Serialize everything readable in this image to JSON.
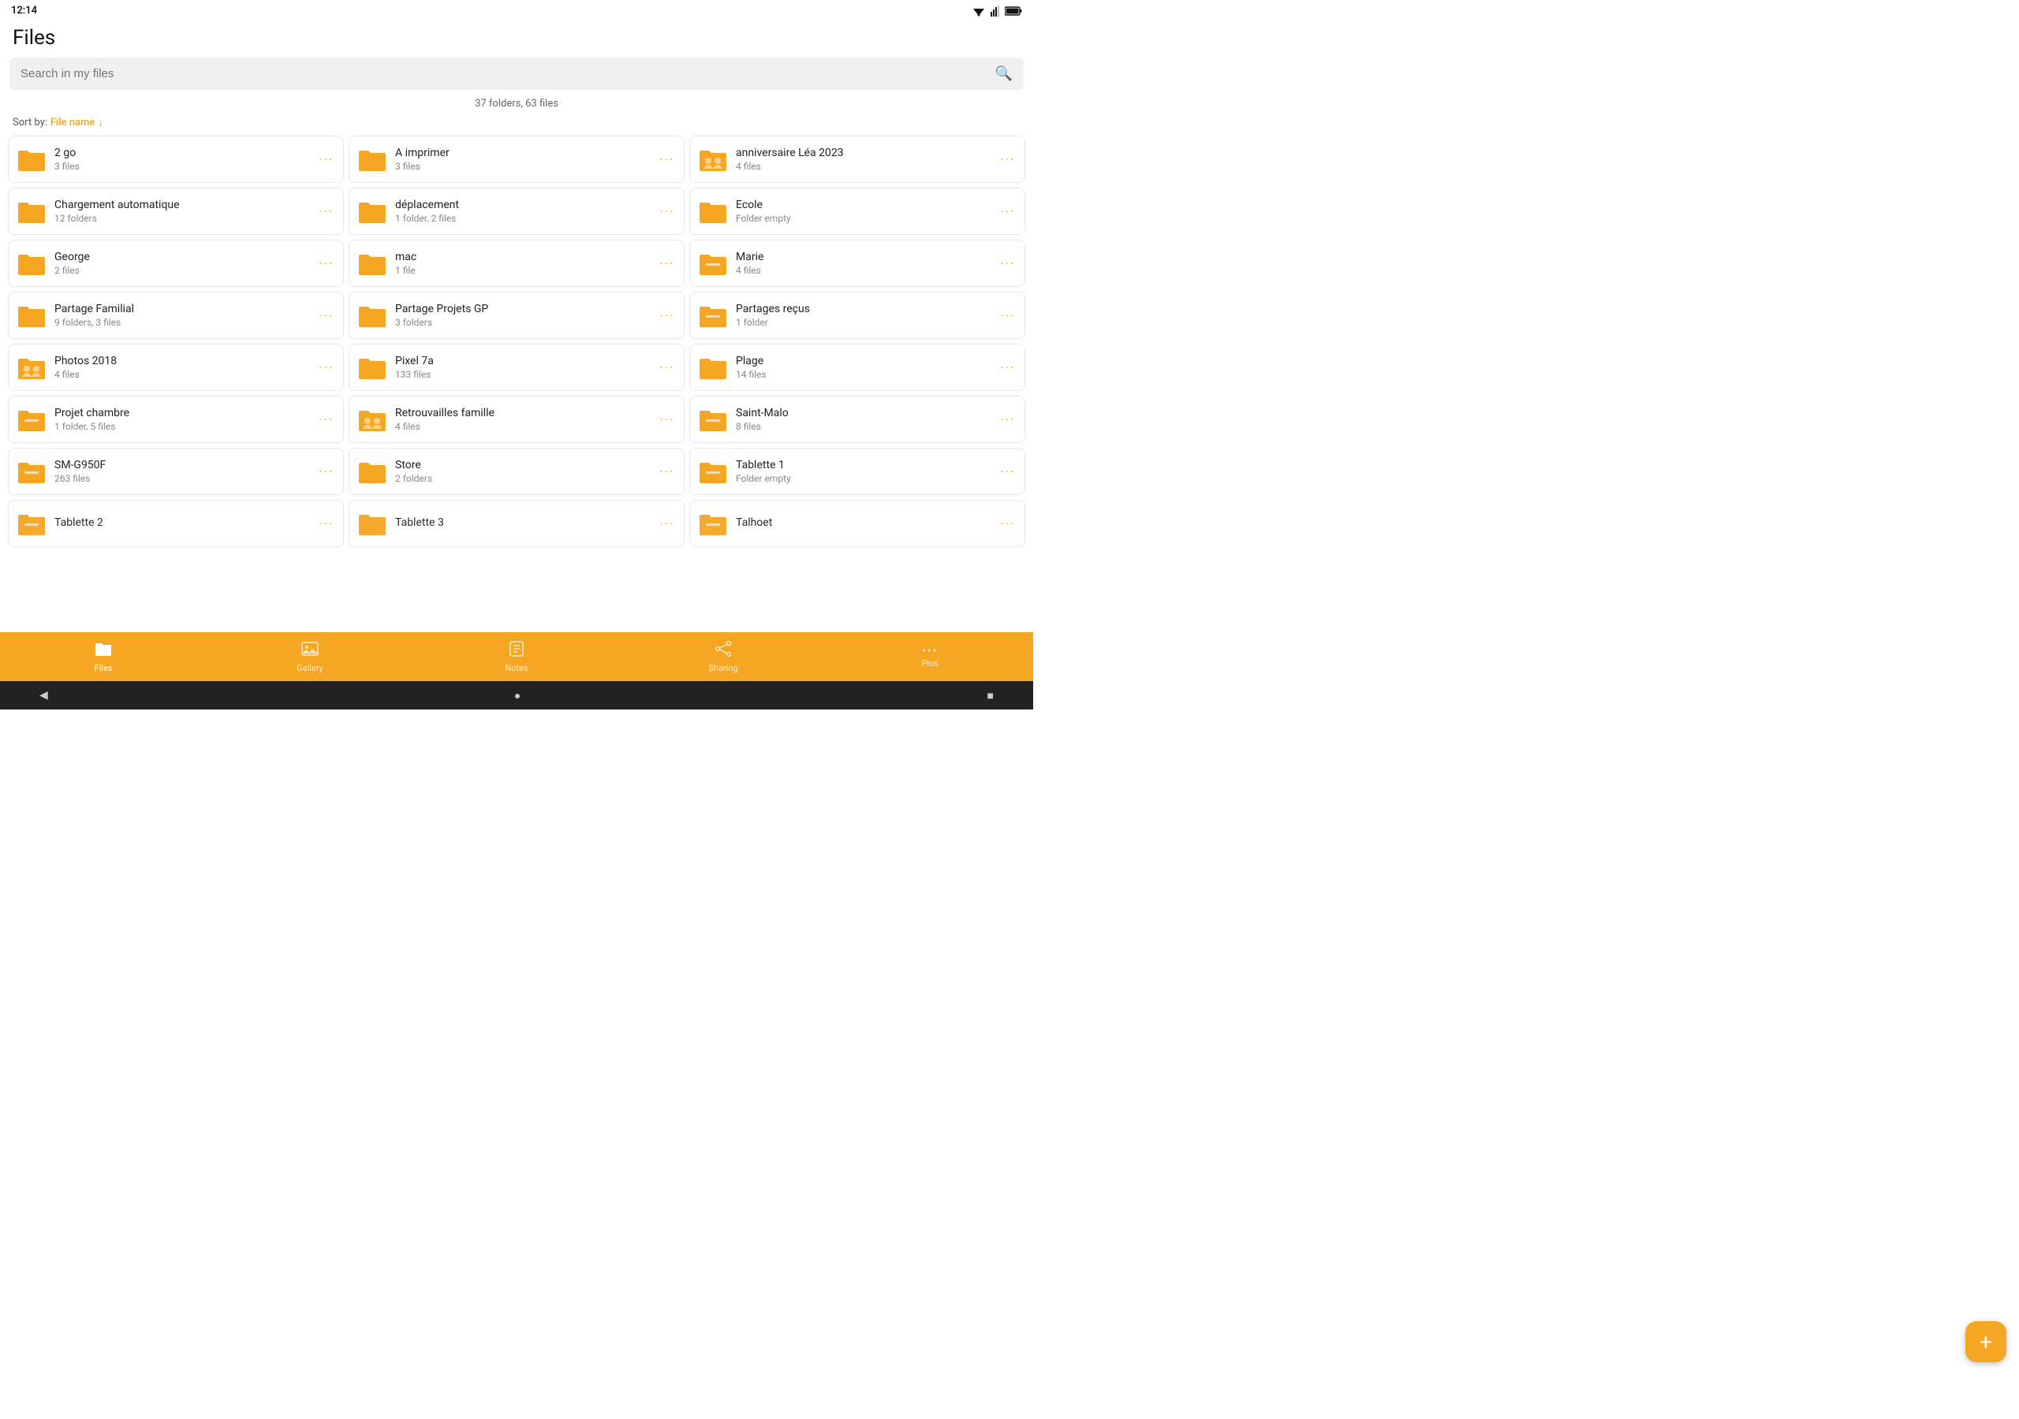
{
  "status": {
    "time": "12:14"
  },
  "header": {
    "title": "Files"
  },
  "search": {
    "placeholder": "Search in my files"
  },
  "meta": {
    "count": "37 folders, 63 files"
  },
  "sort": {
    "label": "Sort by:",
    "value": "File name"
  },
  "folders": [
    {
      "id": 1,
      "name": "2 go",
      "sub": "3 files",
      "icon": "regular"
    },
    {
      "id": 2,
      "name": "A imprimer",
      "sub": "3 files",
      "icon": "regular"
    },
    {
      "id": 3,
      "name": "anniversaire Léa 2023",
      "sub": "4 files",
      "icon": "people"
    },
    {
      "id": 4,
      "name": "Chargement automatique",
      "sub": "12 folders",
      "icon": "regular"
    },
    {
      "id": 5,
      "name": "déplacement",
      "sub": "1 folder, 2 files",
      "icon": "regular"
    },
    {
      "id": 6,
      "name": "Ecole",
      "sub": "Folder empty",
      "icon": "regular"
    },
    {
      "id": 7,
      "name": "George",
      "sub": "2 files",
      "icon": "regular"
    },
    {
      "id": 8,
      "name": "mac",
      "sub": "1 file",
      "icon": "regular"
    },
    {
      "id": 9,
      "name": "Marie",
      "sub": "4 files",
      "icon": "minus"
    },
    {
      "id": 10,
      "name": "Partage Familial",
      "sub": "9 folders, 3 files",
      "icon": "regular"
    },
    {
      "id": 11,
      "name": "Partage Projets GP",
      "sub": "3 folders",
      "icon": "regular"
    },
    {
      "id": 12,
      "name": "Partages reçus",
      "sub": "1 folder",
      "icon": "minus"
    },
    {
      "id": 13,
      "name": "Photos 2018",
      "sub": "4 files",
      "icon": "people"
    },
    {
      "id": 14,
      "name": "Pixel 7a",
      "sub": "133 files",
      "icon": "regular"
    },
    {
      "id": 15,
      "name": "Plage",
      "sub": "14 files",
      "icon": "regular"
    },
    {
      "id": 16,
      "name": "Projet chambre",
      "sub": "1 folder, 5 files",
      "icon": "minus"
    },
    {
      "id": 17,
      "name": "Retrouvailles famille",
      "sub": "4 files",
      "icon": "people"
    },
    {
      "id": 18,
      "name": "Saint-Malo",
      "sub": "8 files",
      "icon": "minus"
    },
    {
      "id": 19,
      "name": "SM-G950F",
      "sub": "263 files",
      "icon": "minus"
    },
    {
      "id": 20,
      "name": "Store",
      "sub": "2 folders",
      "icon": "regular"
    },
    {
      "id": 21,
      "name": "Tablette 1",
      "sub": "Folder empty",
      "icon": "minus"
    },
    {
      "id": 22,
      "name": "Tablette 2",
      "sub": "",
      "icon": "minus"
    },
    {
      "id": 23,
      "name": "Tablette 3",
      "sub": "",
      "icon": "regular"
    },
    {
      "id": 24,
      "name": "Talhoet",
      "sub": "",
      "icon": "minus"
    }
  ],
  "nav": {
    "items": [
      {
        "id": "files",
        "label": "Files",
        "active": true
      },
      {
        "id": "gallery",
        "label": "Gallery",
        "active": false
      },
      {
        "id": "notes",
        "label": "Notes",
        "active": false
      },
      {
        "id": "sharing",
        "label": "Sharing",
        "active": false
      },
      {
        "id": "plus",
        "label": "Plus",
        "active": false
      }
    ]
  },
  "fab": {
    "label": "+"
  },
  "system_nav": {
    "back": "◀",
    "home": "●",
    "square": "■"
  }
}
